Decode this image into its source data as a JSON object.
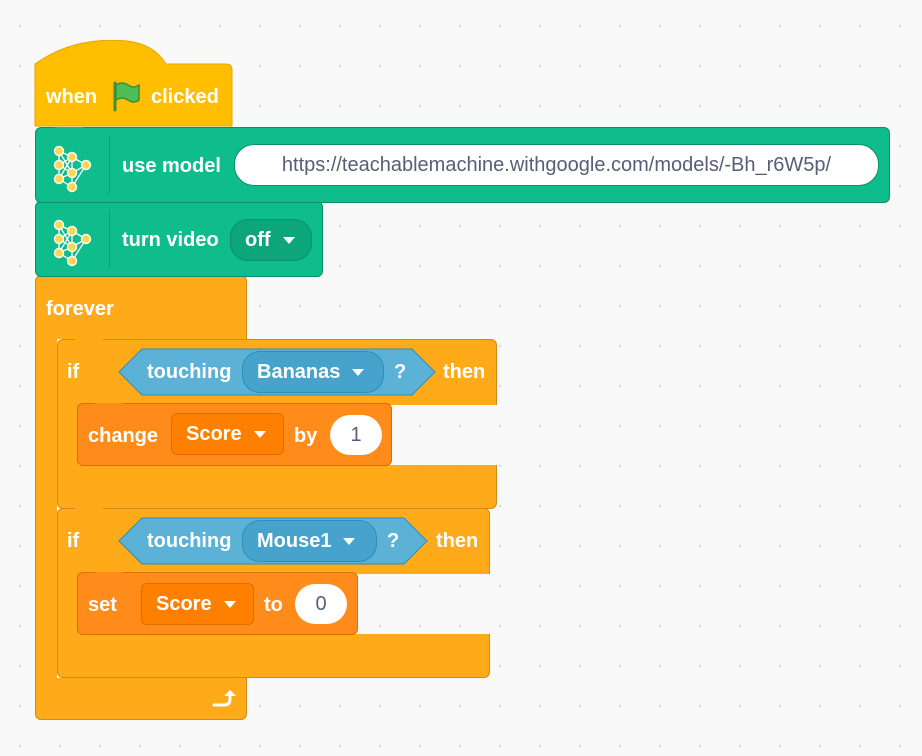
{
  "script": {
    "hat": {
      "prefix": "when",
      "suffix": "clicked",
      "icon": "green-flag-icon"
    },
    "use_model": {
      "label": "use model",
      "url": "https://teachablemachine.withgoogle.com/models/-Bh_r6W5p/",
      "icon": "teachable-machine-icon"
    },
    "turn_video": {
      "label": "turn video",
      "value": "off",
      "icon": "teachable-machine-icon"
    },
    "forever": {
      "label": "forever",
      "loop_icon": "loop-arrow-icon"
    },
    "if1": {
      "if_label": "if",
      "then_label": "then",
      "condition": {
        "label": "touching",
        "target": "Bananas",
        "suffix": "?"
      },
      "body": {
        "label": "change",
        "variable": "Score",
        "by_label": "by",
        "value": "1"
      }
    },
    "if2": {
      "if_label": "if",
      "then_label": "then",
      "condition": {
        "label": "touching",
        "target": "Mouse1",
        "suffix": "?"
      },
      "body": {
        "label": "set",
        "variable": "Score",
        "to_label": "to",
        "value": "0"
      }
    }
  },
  "colors": {
    "events": "#ffbf00",
    "control": "#ffab19",
    "extension": "#0fbd8c",
    "variables": "#ff8c1a",
    "sensing": "#5cb1d6",
    "background": "#f9f9f9"
  }
}
